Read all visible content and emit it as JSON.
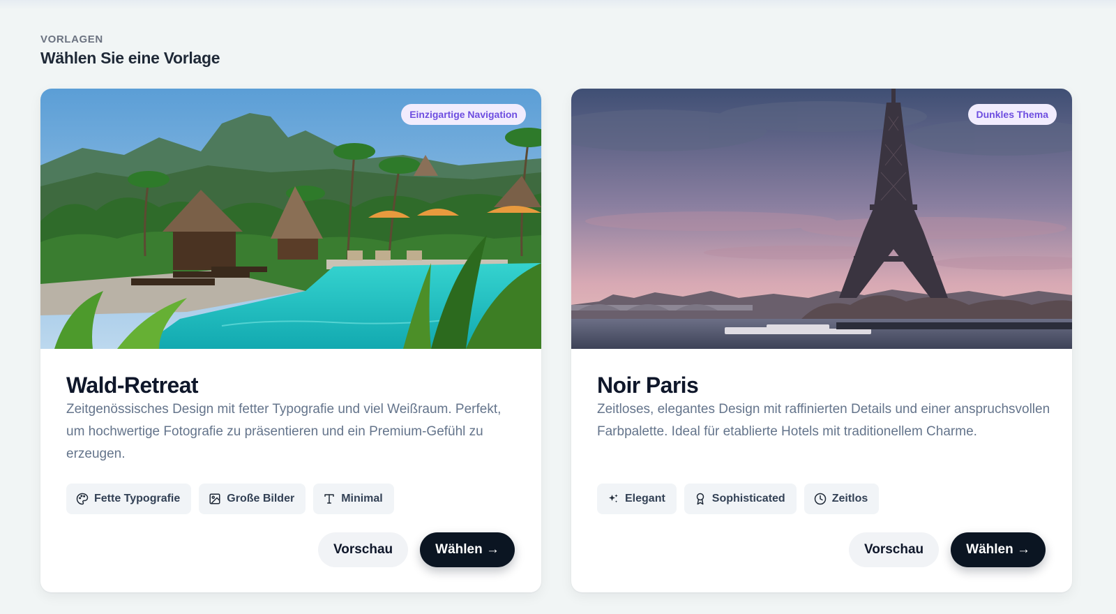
{
  "section": {
    "eyebrow": "VORLAGEN",
    "title": "Wählen Sie eine Vorlage"
  },
  "templates": [
    {
      "badge": "Einzigartige Navigation",
      "title": "Wald-Retreat",
      "description": "Zeitgenössisches Design mit fetter Typografie und viel Weißraum. Perfekt, um hochwertige Fotografie zu präsentieren und ein Premium-Gefühl zu erzeugen.",
      "tags": [
        {
          "label": "Fette Typografie",
          "icon": "palette-icon"
        },
        {
          "label": "Große Bilder",
          "icon": "image-icon"
        },
        {
          "label": "Minimal",
          "icon": "type-icon"
        }
      ],
      "preview_label": "Vorschau",
      "select_label": "Wählen →"
    },
    {
      "badge": "Dunkles Thema",
      "title": "Noir Paris",
      "description": "Zeitloses, elegantes Design mit raffinierten Details und einer anspruchsvollen Farbpalette. Ideal für etablierte Hotels mit traditionellem Charme.",
      "tags": [
        {
          "label": "Elegant",
          "icon": "sparkles-icon"
        },
        {
          "label": "Sophisticated",
          "icon": "award-icon"
        },
        {
          "label": "Zeitlos",
          "icon": "clock-icon"
        }
      ],
      "preview_label": "Vorschau",
      "select_label": "Wählen →"
    }
  ],
  "colors": {
    "background": "#f1f5f5",
    "badge_bg": "#f1ecfd",
    "badge_text": "#6d4de0",
    "primary_button": "#0b1522",
    "tag_bg": "#f1f4f7"
  }
}
